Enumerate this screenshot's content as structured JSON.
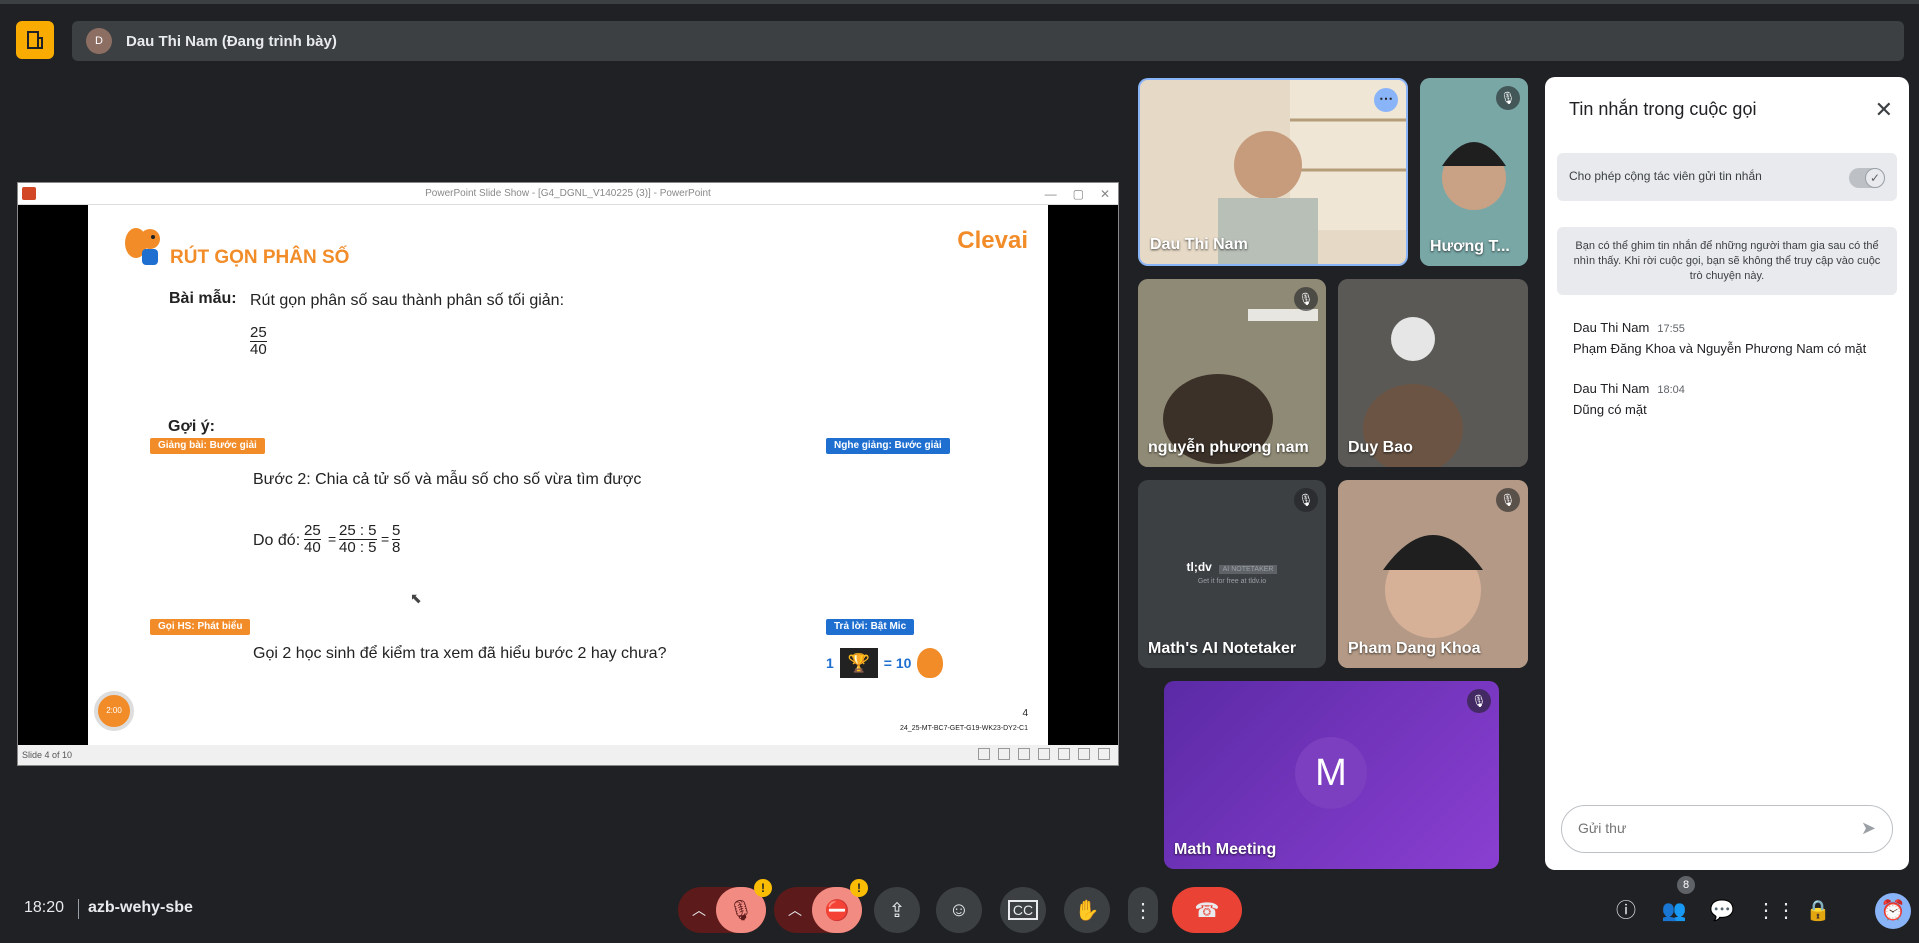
{
  "presenter": {
    "avatar_initial": "D",
    "label": "Dau Thi Nam (Đang trình bày)"
  },
  "ppt": {
    "window_title": "PowerPoint Slide Show - [G4_DGNL_V140225 (3)] - PowerPoint",
    "status": "Slide 4 of 10"
  },
  "slide": {
    "title": "RÚT GỌN PHÂN SỐ",
    "logo": "Clevai",
    "sample_label": "Bài mẫu:",
    "sample_text": "Rút gọn phân số sau thành phân số tối giản:",
    "frac_num": "25",
    "frac_den": "40",
    "hint_label": "Gợi ý:",
    "tag_lecture": "Giảng bài: Bước giải",
    "tag_listen": "Nghe giảng: Bước giải",
    "step_text": "Bước 2: Chia cả tử số và mẫu số cho số vừa tìm được",
    "do_prefix": "Do đó:",
    "eq_a_num": "25",
    "eq_a_den": "40",
    "eq_b_num": "25 : 5",
    "eq_b_den": "40 : 5",
    "eq_c_num": "5",
    "eq_c_den": "8",
    "eq_sign": "=",
    "tag_call": "Gọi HS: Phát biểu",
    "tag_answer": "Trả lời: Bật Mic",
    "call_text": "Gọi 2 học sinh để kiểm tra xem đã hiểu bước 2 hay chưa?",
    "reward_count": "1",
    "reward_eq": "= 10",
    "timer": "2:00",
    "page_number": "4",
    "page_code": "24_25-MT-BC7-GET-G19-WK23-DY2-C1"
  },
  "participants": [
    {
      "name": "Dau Thi Nam",
      "bg": "#d9c9b3"
    },
    {
      "name": "Hương T...",
      "bg": "#6f8f8a"
    },
    {
      "name": "nguyễn phương nam",
      "bg": "#6e6a58"
    },
    {
      "name": "Duy Bao",
      "bg": "#4a4844"
    },
    {
      "name": "Math's AI Notetaker",
      "bg": "#3c4043"
    },
    {
      "name": "Pham Dang Khoa",
      "bg": "#8a7a66"
    },
    {
      "name": "Math Meeting",
      "bg": "#6a2fb0"
    }
  ],
  "notetaker": {
    "brand": "tl;dv",
    "badge": "AI NOTETAKER",
    "tagline": "Get it for free at tldv.io"
  },
  "math_meeting_initial": "M",
  "chat": {
    "title": "Tin nhắn trong cuộc gọi",
    "allow_label": "Cho phép cộng tác viên gửi tin nhắn",
    "info": "Bạn có thể ghim tin nhắn để những người tham gia sau có thể nhìn thấy. Khi rời cuộc gọi, bạn sẽ không thể truy cập vào cuộc trò chuyện này.",
    "messages": [
      {
        "sender": "Dau Thi Nam",
        "time": "17:55",
        "text": "Phạm Đăng Khoa và Nguyễn Phương Nam có mặt"
      },
      {
        "sender": "Dau Thi Nam",
        "time": "18:04",
        "text": "Dũng có mặt"
      }
    ],
    "placeholder": "Gửi thư"
  },
  "bottom": {
    "time": "18:20",
    "meeting_code": "azb-wehy-sbe",
    "people_count": "8"
  },
  "colors": {
    "accent": "#8ab4f8",
    "danger": "#ea4335",
    "brand_orange": "#f28c28",
    "warning": "#fbbc04"
  }
}
